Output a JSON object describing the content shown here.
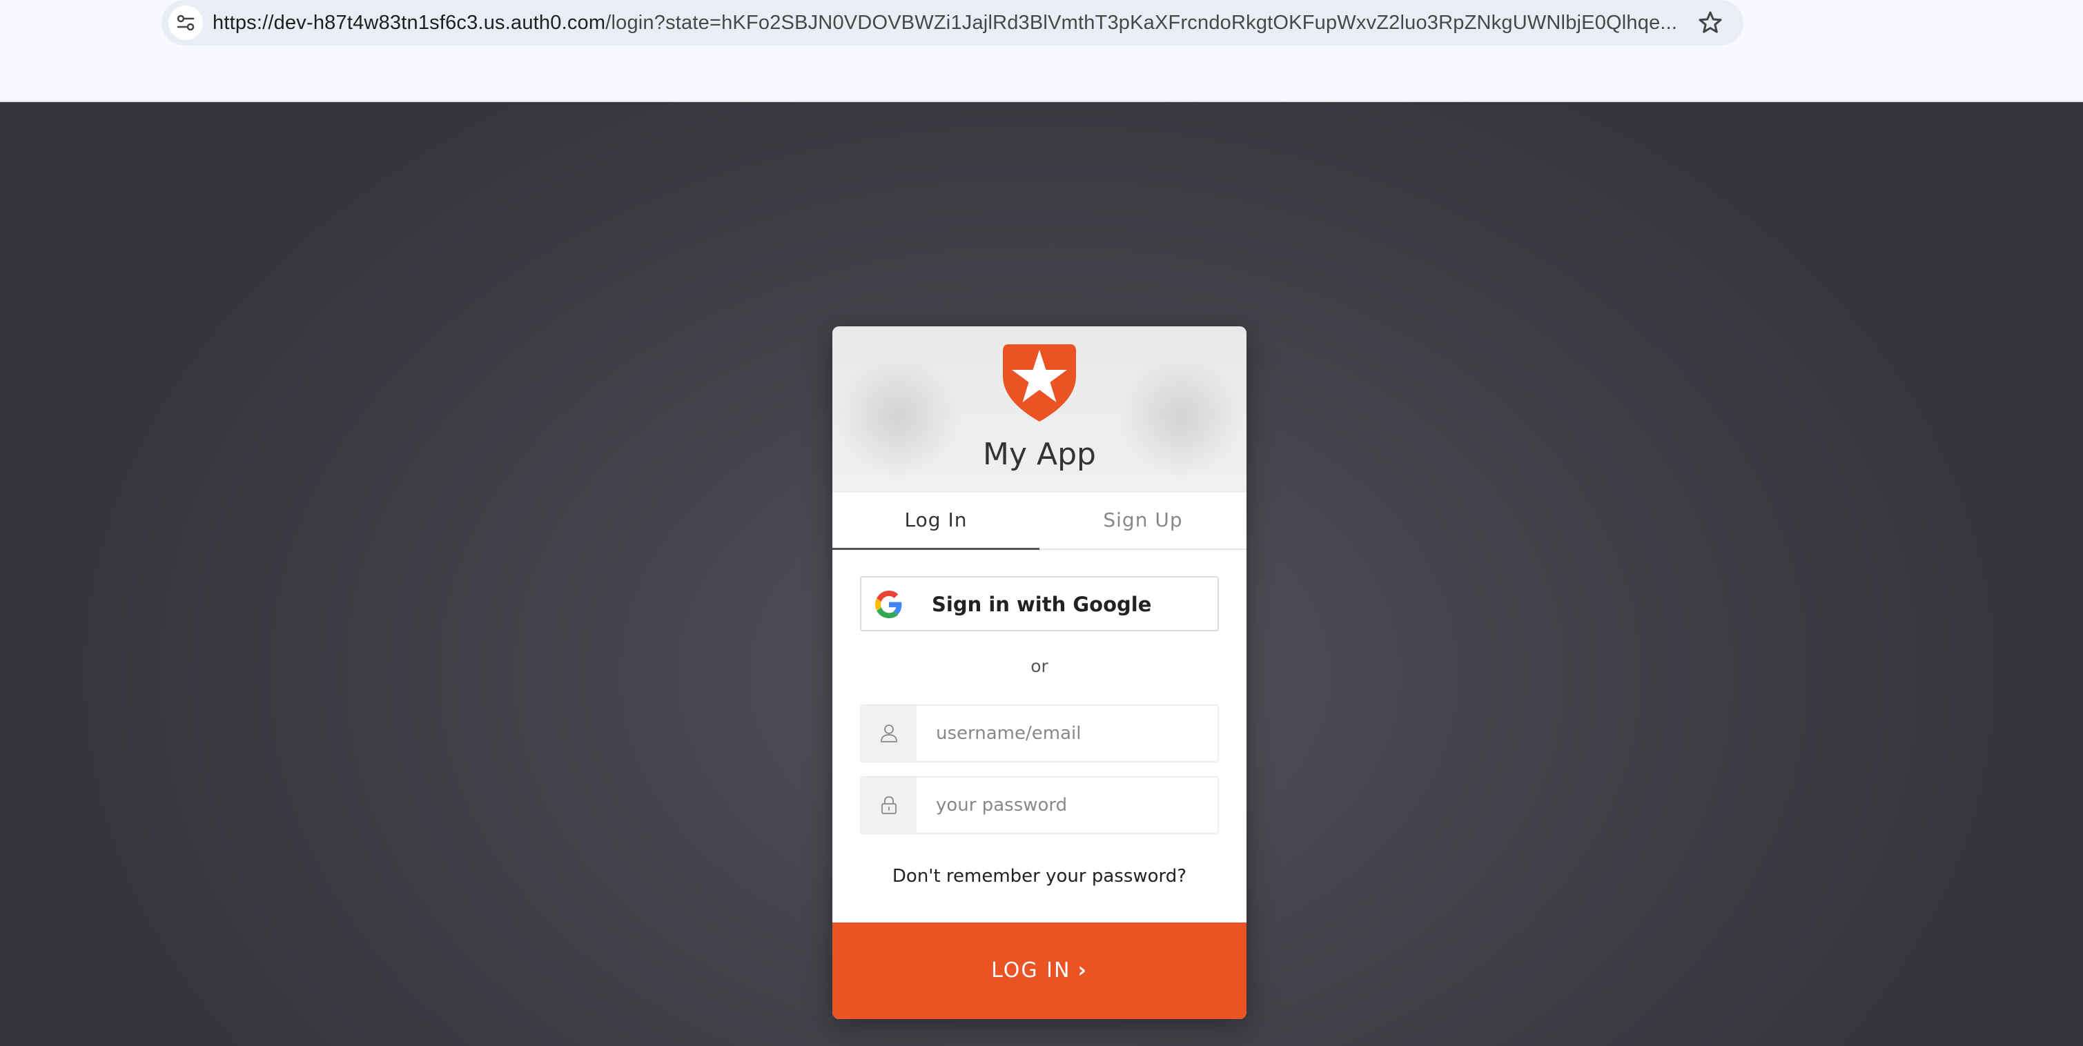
{
  "browser": {
    "url_host": "https://dev-h87t4w83tn1sf6c3.us.auth0.com",
    "url_rest": "/login?state=hKFo2SBJN0VDOVBWZi1JajlRd3BlVmthT3pKaXFrcndoRkgtOKFupWxvZ2luo3RpZNkgUWNlbjE0Qlhqe..."
  },
  "lock": {
    "app_title": "My App",
    "tabs": [
      {
        "label": "Log In",
        "active": true
      },
      {
        "label": "Sign Up",
        "active": false
      }
    ],
    "google_button_label": "Sign in with Google",
    "separator": "or",
    "username_placeholder": "username/email",
    "password_placeholder": "your password",
    "forgot_password_label": "Don't remember your password?",
    "submit_label": "LOG IN",
    "submit_chevron": "›"
  },
  "colors": {
    "brand": "#ea5323",
    "backdrop": "#44444c"
  },
  "icons": [
    "site-info-icon",
    "bookmark-star-icon",
    "auth0-shield-logo",
    "google-g-icon",
    "user-icon",
    "lock-icon"
  ]
}
